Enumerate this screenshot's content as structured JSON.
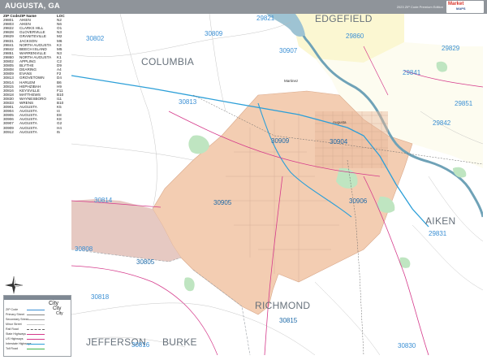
{
  "title": "AUGUSTA, GA",
  "edition": "2023 ZIP Code Premium Edition",
  "brand": {
    "line1": "Market",
    "line2": "MAPS"
  },
  "zip_table": {
    "headers": [
      "ZIP Code",
      "ZIP Name",
      "LOC"
    ],
    "rows": [
      [
        "29801",
        "AIKEN",
        "N2"
      ],
      [
        "29803",
        "AIKEN",
        "N6"
      ],
      [
        "29822",
        "CLARKS HILL",
        "O1"
      ],
      [
        "29828",
        "GLOVERVILLE",
        "N3"
      ],
      [
        "29829",
        "GRANITEVILLE",
        "M2"
      ],
      [
        "29831",
        "JACKSON",
        "M6"
      ],
      [
        "29841",
        "NORTH AUGUSTA",
        "K3"
      ],
      [
        "29842",
        "BEECH ISLAND",
        "M5"
      ],
      [
        "29851",
        "WARRENVILLE",
        "N3"
      ],
      [
        "29860",
        "NORTH AUGUSTA",
        "K1"
      ],
      [
        "30802",
        "APPLING",
        "C2"
      ],
      [
        "30805",
        "BLYTHE",
        "D9"
      ],
      [
        "30808",
        "DEARING",
        "A4"
      ],
      [
        "30809",
        "EVANS",
        "F2"
      ],
      [
        "30813",
        "GROVETOWN",
        "D4"
      ],
      [
        "30814",
        "HARLEM",
        "B6"
      ],
      [
        "30815",
        "HEPHZIBAH",
        "H9"
      ],
      [
        "30816",
        "KEYSVILLE",
        "F11"
      ],
      [
        "30818",
        "MATTHEWS",
        "B10"
      ],
      [
        "30830",
        "WAYNESBORO",
        "I11"
      ],
      [
        "30833",
        "WRENS",
        "B10"
      ],
      [
        "30901",
        "AUGUSTA",
        "K5"
      ],
      [
        "30904",
        "AUGUSTA",
        "I4"
      ],
      [
        "30905",
        "AUGUSTA",
        "E8"
      ],
      [
        "30906",
        "AUGUSTA",
        "K8"
      ],
      [
        "30907",
        "AUGUSTA",
        "G2"
      ],
      [
        "30909",
        "AUGUSTA",
        "H4"
      ],
      [
        "30912",
        "AUGUSTA",
        "I5"
      ]
    ]
  },
  "counties": [
    {
      "name": "COLUMBIA"
    },
    {
      "name": "EDGEFIELD"
    },
    {
      "name": "AIKEN"
    },
    {
      "name": "RICHMOND"
    },
    {
      "name": "JEFFERSON"
    },
    {
      "name": "BURKE"
    }
  ],
  "zip_labels": [
    "29821",
    "30802",
    "30809",
    "30907",
    "29860",
    "29829",
    "29841",
    "29851",
    "30813",
    "29842",
    "30909",
    "30904",
    "30814",
    "30905",
    "30906",
    "30808",
    "30805",
    "29831",
    "30818",
    "30815",
    "30816",
    "30830"
  ],
  "places": [
    "Martinez",
    "Augusta"
  ],
  "legend": {
    "items": [
      "City",
      "City",
      "City",
      "ZIP Code",
      "Primary Street",
      "Secondary Street",
      "Minor Street",
      "Rail Road",
      "State Highways",
      "US Highways",
      "Interstate Highways",
      "Toll Road"
    ]
  },
  "colors": {
    "richmond_fill": "#f3cdb2",
    "columbia_fill": "#fbfbf8",
    "aiken_fill": "#fdfcf4",
    "edgefield_fill": "#fbf7d2",
    "green": "#bfe5c1",
    "river": "#6fa2b7",
    "zip_label": "#3a8fd4",
    "county_label": "#67717b"
  }
}
